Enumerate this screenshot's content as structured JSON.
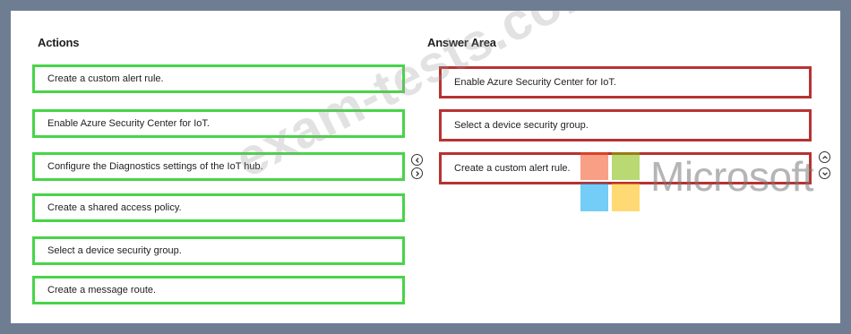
{
  "actions": {
    "title": "Actions",
    "items": [
      "Create a custom alert rule.",
      "Enable Azure Security Center for IoT.",
      "Configure the Diagnostics settings of the IoT hub.",
      "Create a shared access policy.",
      "Select a device security group.",
      "Create a message route."
    ]
  },
  "answer_area": {
    "title": "Answer Area",
    "items": [
      "Enable Azure Security Center for IoT.",
      "Select a device security group.",
      "Create a custom alert rule."
    ]
  },
  "watermarks": {
    "site": "exam-tests.com",
    "brand": "Microsoft"
  },
  "colors": {
    "action_border": "#48d448",
    "answer_border": "#b83232",
    "ms_red": "#f25022",
    "ms_green": "#7fba00",
    "ms_blue": "#00a4ef",
    "ms_yellow": "#ffb900"
  },
  "icons": {
    "move_left": "chevron-left-circle-icon",
    "move_right": "chevron-right-circle-icon",
    "move_up": "chevron-up-circle-icon",
    "move_down": "chevron-down-circle-icon"
  }
}
